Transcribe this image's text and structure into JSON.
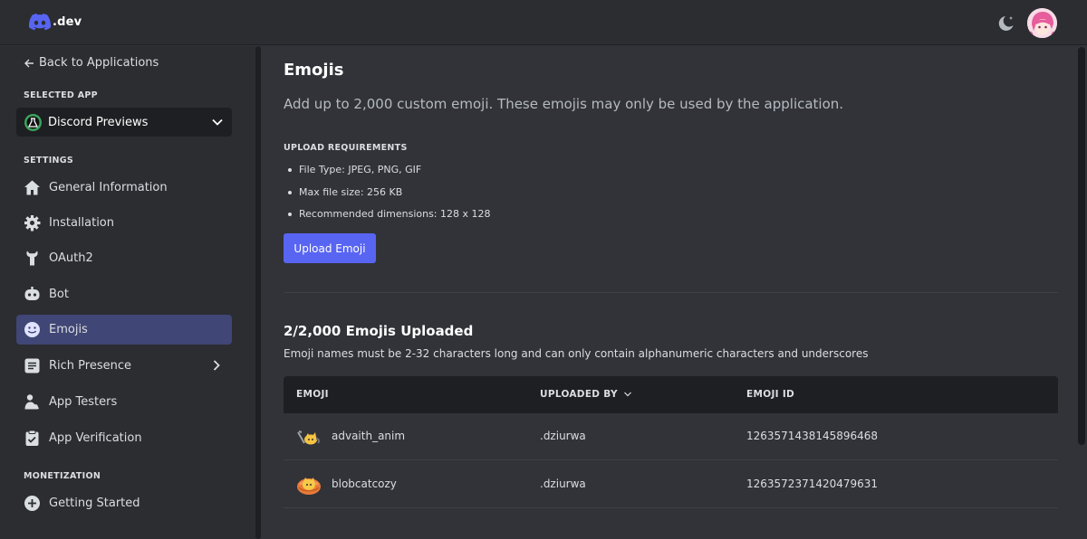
{
  "brand": {
    "name": ".dev"
  },
  "header": {
    "theme_icon": "moon-icon",
    "avatar_icon": "user-avatar"
  },
  "sidebar": {
    "back_label": "Back to Applications",
    "selected_app_label": "SELECTED APP",
    "app_name": "Discord Previews",
    "settings_label": "SETTINGS",
    "items": [
      {
        "label": "General Information",
        "icon": "home-icon"
      },
      {
        "label": "Installation",
        "icon": "gear-icon"
      },
      {
        "label": "OAuth2",
        "icon": "wrench-icon"
      },
      {
        "label": "Bot",
        "icon": "robot-icon"
      },
      {
        "label": "Emojis",
        "icon": "smile-icon",
        "active": true
      },
      {
        "label": "Rich Presence",
        "icon": "list-icon",
        "has_chevron": true
      },
      {
        "label": "App Testers",
        "icon": "person-icon"
      },
      {
        "label": "App Verification",
        "icon": "clipboard-check-icon"
      }
    ],
    "monetization_label": "MONETIZATION",
    "monetization_items": [
      {
        "label": "Getting Started",
        "icon": "plus-circle-icon"
      }
    ]
  },
  "main": {
    "title": "Emojis",
    "description": "Add up to 2,000 custom emoji. These emojis may only be used by the application.",
    "requirements_label": "UPLOAD REQUIREMENTS",
    "requirements": [
      "File Type: JPEG, PNG, GIF",
      "Max file size: 256 KB",
      "Recommended dimensions: 128 x 128"
    ],
    "upload_button": "Upload Emoji",
    "count_title": "2/2,000 Emojis Uploaded",
    "count_desc": "Emoji names must be 2-32 characters long and can only contain alphanumeric characters and underscores",
    "table": {
      "headers": {
        "emoji": "EMOJI",
        "uploaded_by": "UPLOADED BY",
        "emoji_id": "EMOJI ID"
      },
      "rows": [
        {
          "name": "advaith_anim",
          "uploaded_by": ".dziurwa",
          "emoji_id": "1263571438145896468"
        },
        {
          "name": "blobcatcozy",
          "uploaded_by": ".dziurwa",
          "emoji_id": "1263572371420479631"
        }
      ]
    }
  },
  "colors": {
    "accent": "#5865f2",
    "active_nav": "#404675",
    "background": "#313338",
    "sidebar": "#2b2d31"
  }
}
